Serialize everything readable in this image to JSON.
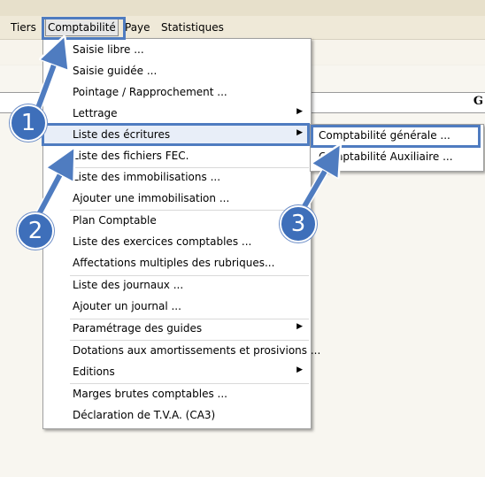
{
  "menubar": {
    "items": [
      "Tiers",
      "Comptabilité",
      "Paye",
      "Statistiques"
    ]
  },
  "grid": {
    "header_fragment": "G"
  },
  "menu": {
    "items": [
      {
        "label": "Saisie libre ...",
        "submenu": false
      },
      {
        "label": "Saisie guidée ...",
        "submenu": false
      },
      {
        "label": "Pointage / Rapprochement ...",
        "submenu": false
      },
      {
        "label": "Lettrage",
        "submenu": true
      },
      {
        "label": "Liste des écritures",
        "submenu": true
      },
      {
        "label": "Liste des fichiers FEC.",
        "submenu": false
      },
      {
        "label": "Liste des immobilisations ...",
        "submenu": false
      },
      {
        "label": "Ajouter une immobilisation ...",
        "submenu": false
      },
      {
        "label": "Plan Comptable",
        "submenu": false
      },
      {
        "label": "Liste des exercices comptables ...",
        "submenu": false
      },
      {
        "label": "Affectations multiples des rubriques...",
        "submenu": false
      },
      {
        "label": "Liste des journaux ...",
        "submenu": false
      },
      {
        "label": "Ajouter un journal ...",
        "submenu": false
      },
      {
        "label": "Paramétrage des guides",
        "submenu": true
      },
      {
        "label": "Dotations aux amortissements et prosivions ...",
        "submenu": false
      },
      {
        "label": "Editions",
        "submenu": true
      },
      {
        "label": "Marges brutes comptables ...",
        "submenu": false
      },
      {
        "label": "Déclaration de T.V.A. (CA3)",
        "submenu": false
      }
    ],
    "submenu_arrow": "▶"
  },
  "submenu": {
    "items": [
      "Comptabilité générale ...",
      "Comptabilité Auxiliaire ..."
    ]
  },
  "callouts": [
    "1",
    "2",
    "3"
  ],
  "colors": {
    "accent": "#4f7cc0",
    "callout_fill": "#3e6fba"
  }
}
